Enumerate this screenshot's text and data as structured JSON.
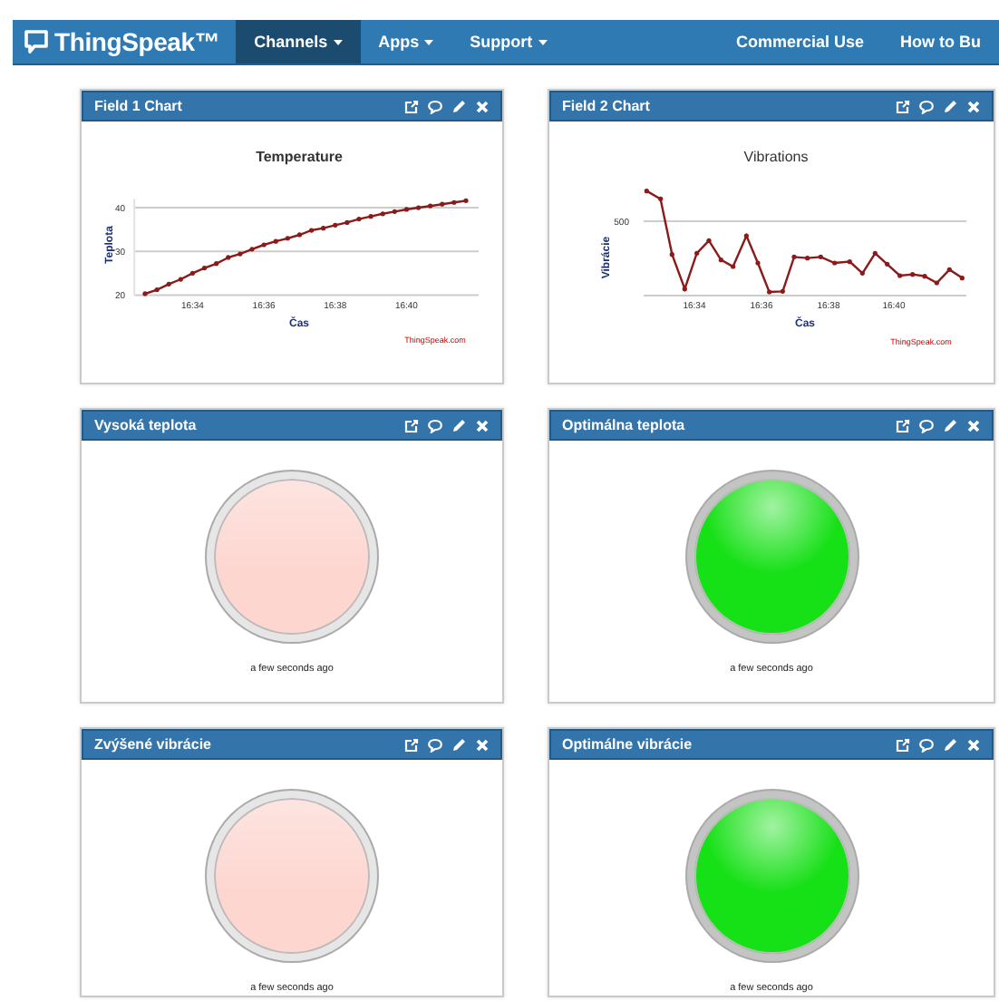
{
  "navbar": {
    "logo": "ThingSpeak™",
    "items": [
      {
        "label": "Channels",
        "selected": true,
        "dropdown": true
      },
      {
        "label": "Apps",
        "selected": false,
        "dropdown": true
      },
      {
        "label": "Support",
        "selected": false,
        "dropdown": true
      }
    ],
    "right_links": [
      "Commercial Use",
      "How to Bu"
    ]
  },
  "panels": [
    {
      "title": "Field 1 Chart",
      "kind": "chart",
      "credit": "ThingSpeak.com",
      "chart_data": {
        "type": "line",
        "title": "Temperature",
        "xlabel": "Čas",
        "ylabel": "Teplota",
        "categories": [
          null,
          null,
          null,
          null,
          "16:34",
          null,
          null,
          null,
          null,
          null,
          "16:36",
          null,
          null,
          null,
          null,
          null,
          "16:38",
          null,
          null,
          null,
          null,
          null,
          "16:40",
          null,
          null,
          null,
          null,
          null
        ],
        "series": [
          {
            "color": "#8b1a1a",
            "values": [
              20.3,
              21.2,
              22.5,
              23.6,
              25,
              26.2,
              27.2,
              28.6,
              29.4,
              30.5,
              31.5,
              32.3,
              33,
              33.8,
              34.8,
              35.3,
              36,
              36.6,
              37.4,
              38,
              38.6,
              39.1,
              39.6,
              40,
              40.4,
              40.8,
              41.2,
              41.6
            ]
          }
        ],
        "ylim": [
          20,
          42
        ],
        "yticks": [
          20,
          30,
          40
        ]
      }
    },
    {
      "title": "Field 2 Chart",
      "kind": "picture-chart",
      "credit": "ThingSpeak.com",
      "picture": {
        "title": "Vibrations",
        "ylabel": "Vibrácie",
        "ytick_labels": [
          "500"
        ],
        "xtick_labels": [
          "16:34",
          "16:36",
          "16:38",
          "16:40"
        ],
        "xlabel": "Čas"
      }
    },
    {
      "title": "Vysoká teplota",
      "kind": "lamp",
      "lamp": {
        "on": false,
        "color": "#fdd6d0"
      },
      "caption": "a few seconds ago"
    },
    {
      "title": "Optimálna teplota",
      "kind": "lamp",
      "lamp": {
        "on": true,
        "color": "#16e016"
      },
      "caption": "a few seconds ago"
    },
    {
      "title": "Zvýšené vibrácie",
      "kind": "lamp",
      "lamp": {
        "on": false,
        "color": "#fdd6d0"
      },
      "caption": "a few seconds ago"
    },
    {
      "title": "Optimálne vibrácie",
      "kind": "lamp",
      "lamp": {
        "on": true,
        "color": "#16e016"
      },
      "caption": "a few seconds ago"
    }
  ]
}
